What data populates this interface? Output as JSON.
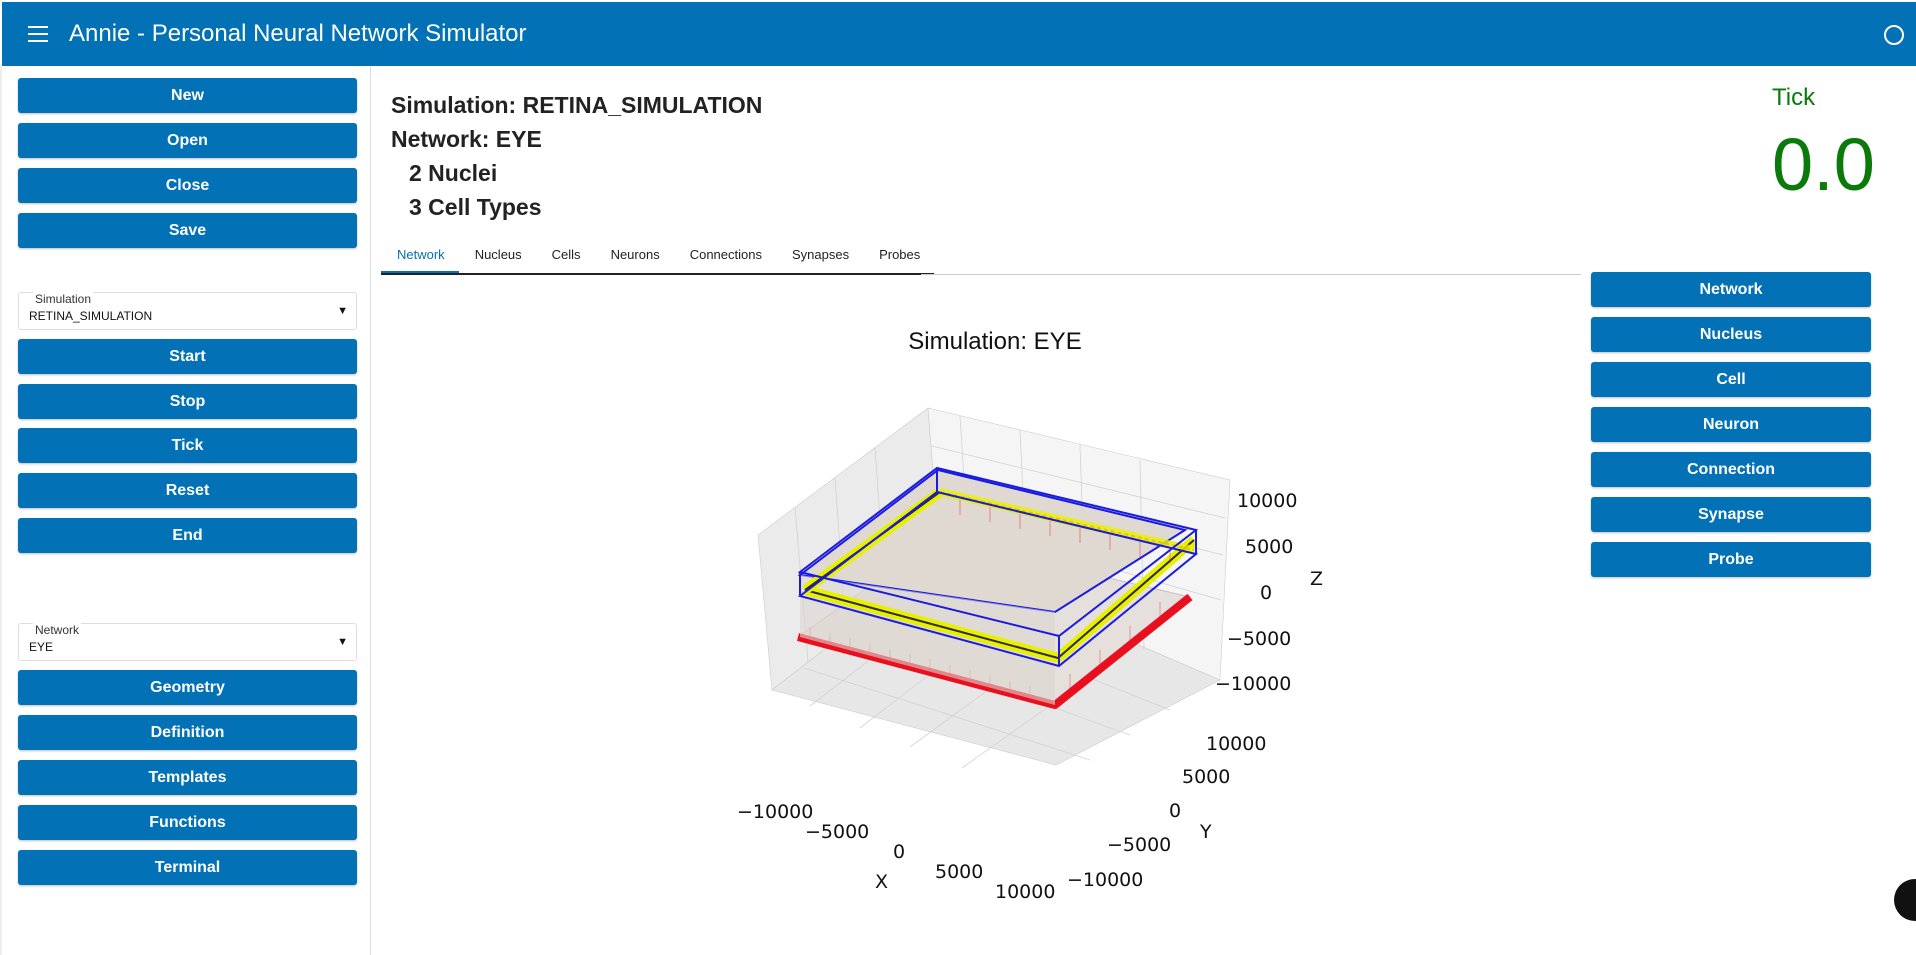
{
  "app": {
    "title": "Annie - Personal Neural Network Simulator"
  },
  "sidebar": {
    "file_buttons": [
      "New",
      "Open",
      "Close",
      "Save"
    ],
    "simulation_select": {
      "label": "Simulation",
      "value": "RETINA_SIMULATION"
    },
    "sim_buttons": [
      "Start",
      "Stop",
      "Tick",
      "Reset",
      "End"
    ],
    "network_select": {
      "label": "Network",
      "value": "EYE"
    },
    "network_buttons": [
      "Geometry",
      "Definition",
      "Templates",
      "Functions",
      "Terminal"
    ]
  },
  "info": {
    "simulation": "Simulation: RETINA_SIMULATION",
    "network": "Network: EYE",
    "nuclei": "2 Nuclei",
    "cell_types": "3 Cell Types"
  },
  "tick": {
    "label": "Tick",
    "value": "0.0"
  },
  "tabs": [
    "Network",
    "Nucleus",
    "Cells",
    "Neurons",
    "Connections",
    "Synapses",
    "Probes"
  ],
  "active_tab": "Network",
  "right_buttons": [
    "Network",
    "Nucleus",
    "Cell",
    "Neuron",
    "Connection",
    "Synapse",
    "Probe"
  ],
  "plot": {
    "title": "Simulation: EYE",
    "x_label": "X",
    "y_label": "Y",
    "z_label": "Z",
    "x_ticks": [
      "−10000",
      "−5000",
      "0",
      "5000",
      "10000"
    ],
    "y_ticks": [
      "10000",
      "5000",
      "0",
      "−5000",
      "−10000"
    ],
    "z_ticks": [
      "10000",
      "5000",
      "0",
      "−5000",
      "−10000"
    ]
  }
}
